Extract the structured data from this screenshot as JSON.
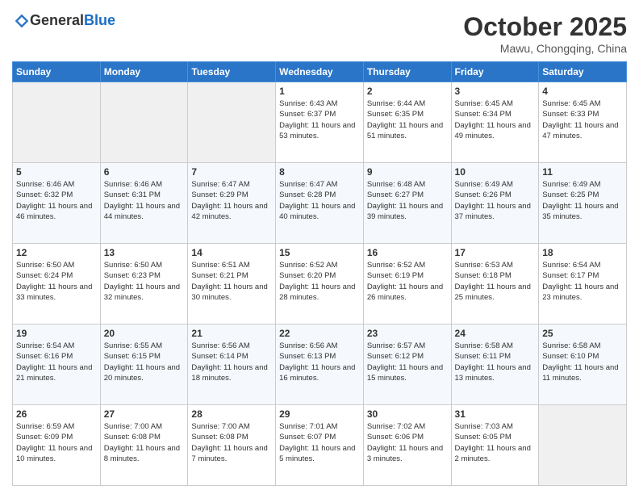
{
  "header": {
    "logo_general": "General",
    "logo_blue": "Blue",
    "month_title": "October 2025",
    "location": "Mawu, Chongqing, China"
  },
  "weekdays": [
    "Sunday",
    "Monday",
    "Tuesday",
    "Wednesday",
    "Thursday",
    "Friday",
    "Saturday"
  ],
  "weeks": [
    [
      {
        "day": "",
        "sunrise": "",
        "sunset": "",
        "daylight": ""
      },
      {
        "day": "",
        "sunrise": "",
        "sunset": "",
        "daylight": ""
      },
      {
        "day": "",
        "sunrise": "",
        "sunset": "",
        "daylight": ""
      },
      {
        "day": "1",
        "sunrise": "Sunrise: 6:43 AM",
        "sunset": "Sunset: 6:37 PM",
        "daylight": "Daylight: 11 hours and 53 minutes."
      },
      {
        "day": "2",
        "sunrise": "Sunrise: 6:44 AM",
        "sunset": "Sunset: 6:35 PM",
        "daylight": "Daylight: 11 hours and 51 minutes."
      },
      {
        "day": "3",
        "sunrise": "Sunrise: 6:45 AM",
        "sunset": "Sunset: 6:34 PM",
        "daylight": "Daylight: 11 hours and 49 minutes."
      },
      {
        "day": "4",
        "sunrise": "Sunrise: 6:45 AM",
        "sunset": "Sunset: 6:33 PM",
        "daylight": "Daylight: 11 hours and 47 minutes."
      }
    ],
    [
      {
        "day": "5",
        "sunrise": "Sunrise: 6:46 AM",
        "sunset": "Sunset: 6:32 PM",
        "daylight": "Daylight: 11 hours and 46 minutes."
      },
      {
        "day": "6",
        "sunrise": "Sunrise: 6:46 AM",
        "sunset": "Sunset: 6:31 PM",
        "daylight": "Daylight: 11 hours and 44 minutes."
      },
      {
        "day": "7",
        "sunrise": "Sunrise: 6:47 AM",
        "sunset": "Sunset: 6:29 PM",
        "daylight": "Daylight: 11 hours and 42 minutes."
      },
      {
        "day": "8",
        "sunrise": "Sunrise: 6:47 AM",
        "sunset": "Sunset: 6:28 PM",
        "daylight": "Daylight: 11 hours and 40 minutes."
      },
      {
        "day": "9",
        "sunrise": "Sunrise: 6:48 AM",
        "sunset": "Sunset: 6:27 PM",
        "daylight": "Daylight: 11 hours and 39 minutes."
      },
      {
        "day": "10",
        "sunrise": "Sunrise: 6:49 AM",
        "sunset": "Sunset: 6:26 PM",
        "daylight": "Daylight: 11 hours and 37 minutes."
      },
      {
        "day": "11",
        "sunrise": "Sunrise: 6:49 AM",
        "sunset": "Sunset: 6:25 PM",
        "daylight": "Daylight: 11 hours and 35 minutes."
      }
    ],
    [
      {
        "day": "12",
        "sunrise": "Sunrise: 6:50 AM",
        "sunset": "Sunset: 6:24 PM",
        "daylight": "Daylight: 11 hours and 33 minutes."
      },
      {
        "day": "13",
        "sunrise": "Sunrise: 6:50 AM",
        "sunset": "Sunset: 6:23 PM",
        "daylight": "Daylight: 11 hours and 32 minutes."
      },
      {
        "day": "14",
        "sunrise": "Sunrise: 6:51 AM",
        "sunset": "Sunset: 6:21 PM",
        "daylight": "Daylight: 11 hours and 30 minutes."
      },
      {
        "day": "15",
        "sunrise": "Sunrise: 6:52 AM",
        "sunset": "Sunset: 6:20 PM",
        "daylight": "Daylight: 11 hours and 28 minutes."
      },
      {
        "day": "16",
        "sunrise": "Sunrise: 6:52 AM",
        "sunset": "Sunset: 6:19 PM",
        "daylight": "Daylight: 11 hours and 26 minutes."
      },
      {
        "day": "17",
        "sunrise": "Sunrise: 6:53 AM",
        "sunset": "Sunset: 6:18 PM",
        "daylight": "Daylight: 11 hours and 25 minutes."
      },
      {
        "day": "18",
        "sunrise": "Sunrise: 6:54 AM",
        "sunset": "Sunset: 6:17 PM",
        "daylight": "Daylight: 11 hours and 23 minutes."
      }
    ],
    [
      {
        "day": "19",
        "sunrise": "Sunrise: 6:54 AM",
        "sunset": "Sunset: 6:16 PM",
        "daylight": "Daylight: 11 hours and 21 minutes."
      },
      {
        "day": "20",
        "sunrise": "Sunrise: 6:55 AM",
        "sunset": "Sunset: 6:15 PM",
        "daylight": "Daylight: 11 hours and 20 minutes."
      },
      {
        "day": "21",
        "sunrise": "Sunrise: 6:56 AM",
        "sunset": "Sunset: 6:14 PM",
        "daylight": "Daylight: 11 hours and 18 minutes."
      },
      {
        "day": "22",
        "sunrise": "Sunrise: 6:56 AM",
        "sunset": "Sunset: 6:13 PM",
        "daylight": "Daylight: 11 hours and 16 minutes."
      },
      {
        "day": "23",
        "sunrise": "Sunrise: 6:57 AM",
        "sunset": "Sunset: 6:12 PM",
        "daylight": "Daylight: 11 hours and 15 minutes."
      },
      {
        "day": "24",
        "sunrise": "Sunrise: 6:58 AM",
        "sunset": "Sunset: 6:11 PM",
        "daylight": "Daylight: 11 hours and 13 minutes."
      },
      {
        "day": "25",
        "sunrise": "Sunrise: 6:58 AM",
        "sunset": "Sunset: 6:10 PM",
        "daylight": "Daylight: 11 hours and 11 minutes."
      }
    ],
    [
      {
        "day": "26",
        "sunrise": "Sunrise: 6:59 AM",
        "sunset": "Sunset: 6:09 PM",
        "daylight": "Daylight: 11 hours and 10 minutes."
      },
      {
        "day": "27",
        "sunrise": "Sunrise: 7:00 AM",
        "sunset": "Sunset: 6:08 PM",
        "daylight": "Daylight: 11 hours and 8 minutes."
      },
      {
        "day": "28",
        "sunrise": "Sunrise: 7:00 AM",
        "sunset": "Sunset: 6:08 PM",
        "daylight": "Daylight: 11 hours and 7 minutes."
      },
      {
        "day": "29",
        "sunrise": "Sunrise: 7:01 AM",
        "sunset": "Sunset: 6:07 PM",
        "daylight": "Daylight: 11 hours and 5 minutes."
      },
      {
        "day": "30",
        "sunrise": "Sunrise: 7:02 AM",
        "sunset": "Sunset: 6:06 PM",
        "daylight": "Daylight: 11 hours and 3 minutes."
      },
      {
        "day": "31",
        "sunrise": "Sunrise: 7:03 AM",
        "sunset": "Sunset: 6:05 PM",
        "daylight": "Daylight: 11 hours and 2 minutes."
      },
      {
        "day": "",
        "sunrise": "",
        "sunset": "",
        "daylight": ""
      }
    ]
  ]
}
